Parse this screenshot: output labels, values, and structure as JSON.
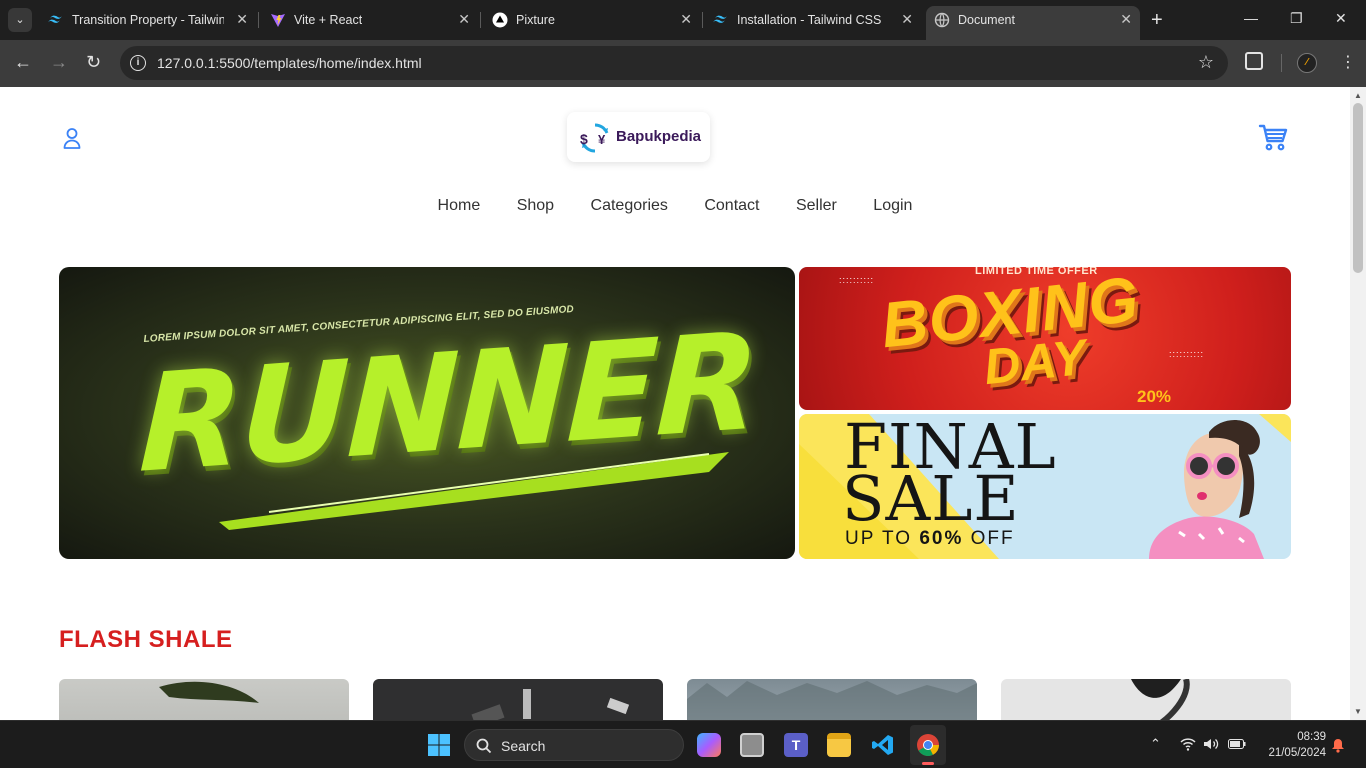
{
  "browser": {
    "tabs": [
      {
        "title": "Transition Property - Tailwind",
        "icon": "tailwind-icon"
      },
      {
        "title": "Vite + React",
        "icon": "vite-icon"
      },
      {
        "title": "Pixture",
        "icon": "pixture-icon"
      },
      {
        "title": "Installation - Tailwind CSS",
        "icon": "tailwind-icon"
      },
      {
        "title": "Document",
        "icon": "globe-icon",
        "active": true
      }
    ],
    "url": "127.0.0.1:5500/templates/home/index.html"
  },
  "site": {
    "brand": "Bapukpedia",
    "nav": [
      "Home",
      "Shop",
      "Categories",
      "Contact",
      "Seller",
      "Login"
    ],
    "hero": {
      "tagline": "LOREM IPSUM DOLOR SIT AMET, CONSECTETUR ADIPISCING ELIT, SED DO EIUSMOD",
      "title": "RUNNER"
    },
    "banner_boxing": {
      "caption": "LIMITED TIME OFFER",
      "line1": "BOXING",
      "line2": "DAY",
      "percent": "20%"
    },
    "banner_sale": {
      "line1": "FINAL",
      "line2": "SALE",
      "line3_prefix": "UP TO ",
      "line3_bold": "60%",
      "line3_suffix": " OFF"
    },
    "section_title": "FLASH SHALE"
  },
  "taskbar": {
    "search_label": "Search",
    "time": "08:39",
    "date": "21/05/2024"
  },
  "colors": {
    "accent_blue": "#3b82f6",
    "flash_red": "#d61f1f",
    "runner_green": "#b6f02a"
  }
}
